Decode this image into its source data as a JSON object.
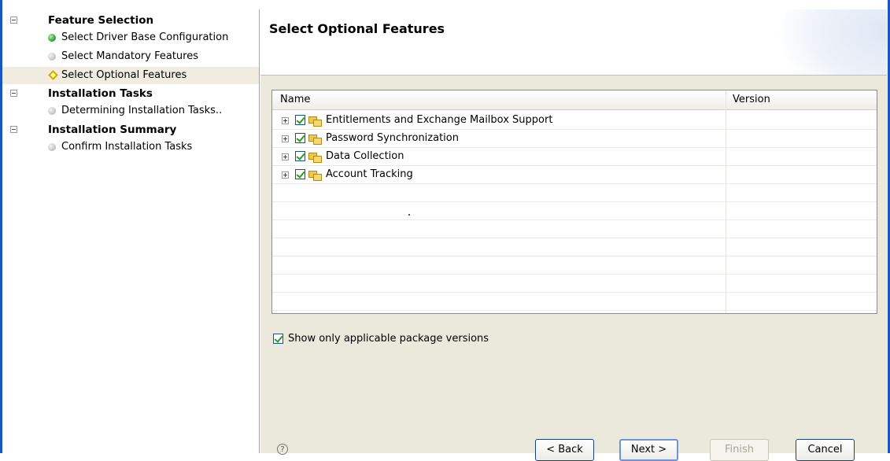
{
  "navigation": {
    "groups": [
      {
        "label": "Feature Selection",
        "steps": [
          {
            "label": "Select Driver Base Configuration",
            "status": "complete"
          },
          {
            "label": "Select Mandatory Features",
            "status": "pending"
          },
          {
            "label": "Select Optional Features",
            "status": "current"
          }
        ]
      },
      {
        "label": "Installation Tasks",
        "steps": [
          {
            "label": "Determining Installation Tasks..",
            "status": "pending"
          }
        ]
      },
      {
        "label": "Installation Summary",
        "steps": [
          {
            "label": "Confirm Installation Tasks",
            "status": "pending"
          }
        ]
      }
    ]
  },
  "page": {
    "title": "Select Optional Features"
  },
  "features_table": {
    "columns": [
      "Name",
      "Version"
    ],
    "rows": [
      {
        "name": "Entitlements and Exchange Mailbox Support",
        "version": "",
        "checked": true
      },
      {
        "name": "Password Synchronization",
        "version": "",
        "checked": true
      },
      {
        "name": "Data Collection",
        "version": "",
        "checked": true
      },
      {
        "name": "Account Tracking",
        "version": "",
        "checked": true
      }
    ]
  },
  "options": {
    "show_applicable_label": "Show only applicable package versions",
    "show_applicable_checked": true
  },
  "buttons": {
    "back": "< Back",
    "next": "Next >",
    "finish": "Finish",
    "cancel": "Cancel",
    "finish_enabled": false
  },
  "help_icon": "?",
  "colors": {
    "frame": "#1a54c7",
    "selected_row": "#f0ecdf",
    "panel_background": "#ebe9dc",
    "check_green": "#21a121"
  }
}
